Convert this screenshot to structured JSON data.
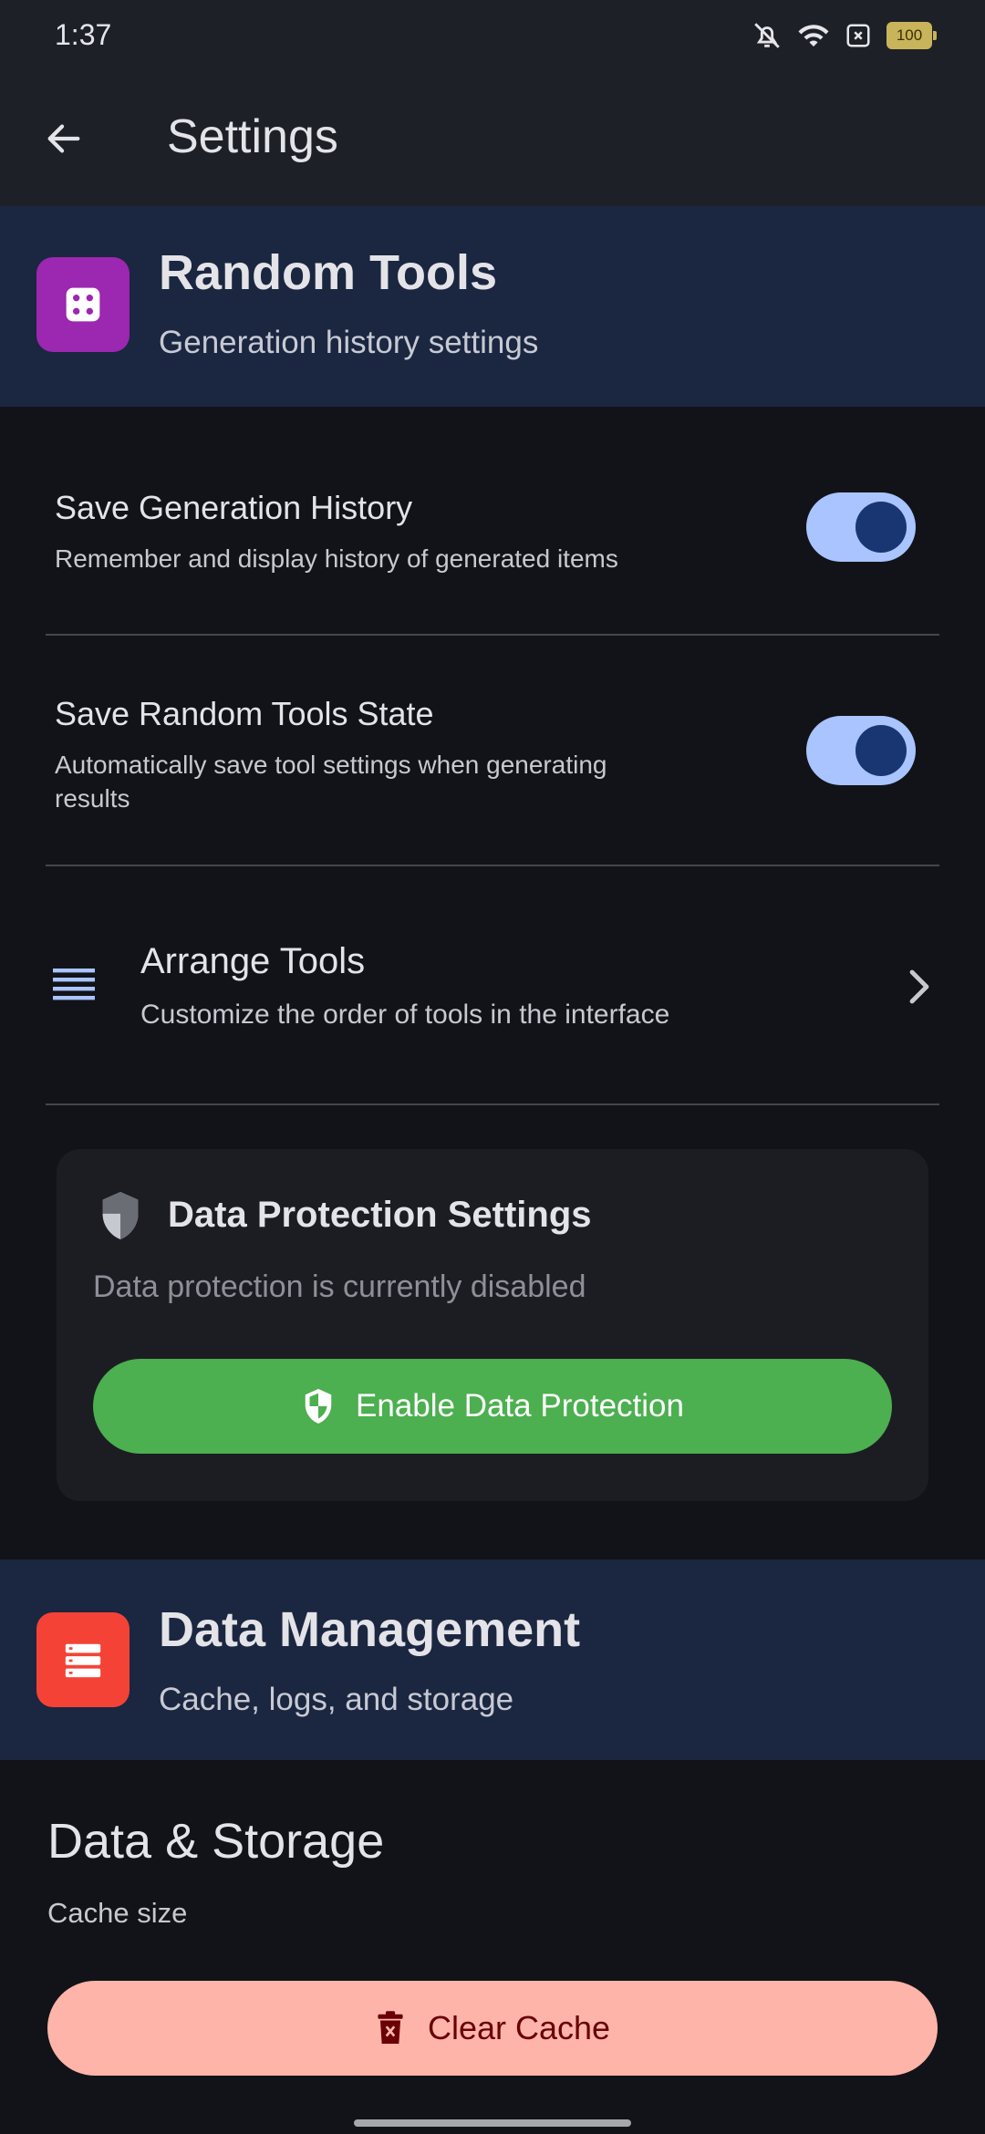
{
  "status_bar": {
    "time": "1:37",
    "battery": "100"
  },
  "app_bar": {
    "title": "Settings"
  },
  "random_tools": {
    "title": "Random Tools",
    "subtitle": "Generation history settings",
    "icon_color": "#9c27b0"
  },
  "settings": {
    "save_history": {
      "title": "Save Generation History",
      "description": "Remember and display history of generated items",
      "enabled": true
    },
    "save_state": {
      "title": "Save Random Tools State",
      "description": "Automatically save tool settings when generating results",
      "enabled": true
    },
    "arrange": {
      "title": "Arrange Tools",
      "description": "Customize the order of tools in the interface"
    }
  },
  "data_protection": {
    "title": "Data Protection Settings",
    "status": "Data protection is currently disabled",
    "button_label": "Enable Data Protection",
    "button_color": "#4caf50"
  },
  "data_management": {
    "title": "Data Management",
    "subtitle": "Cache, logs, and storage",
    "icon_color": "#f44336"
  },
  "storage": {
    "title": "Data & Storage",
    "cache_label": "Cache size",
    "clear_button": "Clear Cache",
    "clear_button_color": "#ffb4a9"
  },
  "icons": [
    "bell-off-icon",
    "wifi-icon",
    "sim-x-icon",
    "battery-icon",
    "back-arrow-icon",
    "dice-icon",
    "list-icon",
    "chevron-right-icon",
    "shield-icon",
    "server-icon",
    "trash-icon"
  ]
}
